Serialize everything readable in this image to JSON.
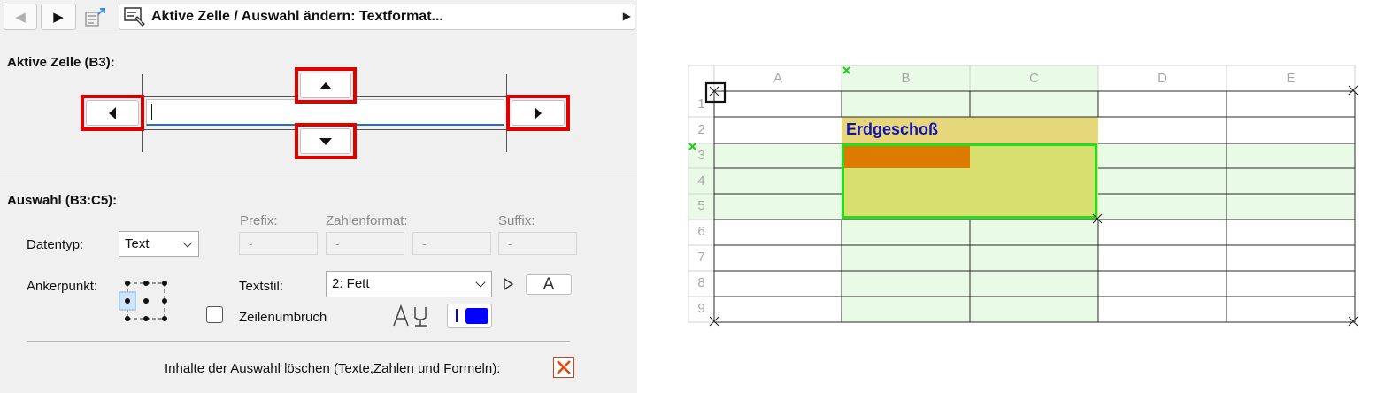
{
  "toolbar": {
    "back": "◀",
    "forward": "▶",
    "title": "Aktive Zelle / Auswahl ändern: Textformat...",
    "more": "▶"
  },
  "active_cell": {
    "label": "Aktive Zelle (B3):",
    "input_value": ""
  },
  "selection": {
    "label": "Auswahl (B3:C5):",
    "datatype_label": "Datentyp:",
    "datatype_value": "Text",
    "prefix_label": "Prefix:",
    "prefix_value": "-",
    "numformat_label": "Zahlenformat:",
    "numformat_value_1": "-",
    "numformat_value_2": "-",
    "suffix_label": "Suffix:",
    "suffix_value": "-",
    "anchor_label": "Ankerpunkt:",
    "textstyle_label": "Textstil:",
    "textstyle_value": "2: Fett",
    "font_button": "A",
    "wrap_label": "Zeilenumbruch",
    "wrap_checked": false,
    "clear_label": "Inhalte der Auswahl löschen (Texte,Zahlen und Formeln):"
  },
  "colors": {
    "highlight_red": "#e00000",
    "text_color_swatch": "#0000ff",
    "selection_green": "#22dd22",
    "cell_yellow": "#d8df6e",
    "header_cell": "#e6d87a",
    "active_orange": "#dd7a00",
    "column_tint": "#e9fbe6",
    "heading_text": "#1414b0"
  },
  "sheet": {
    "columns": [
      "A",
      "B",
      "C",
      "D",
      "E"
    ],
    "rows": [
      "1",
      "2",
      "3",
      "4",
      "5",
      "6",
      "7",
      "8",
      "9"
    ],
    "cell_b2": "Erdgeschoß"
  }
}
